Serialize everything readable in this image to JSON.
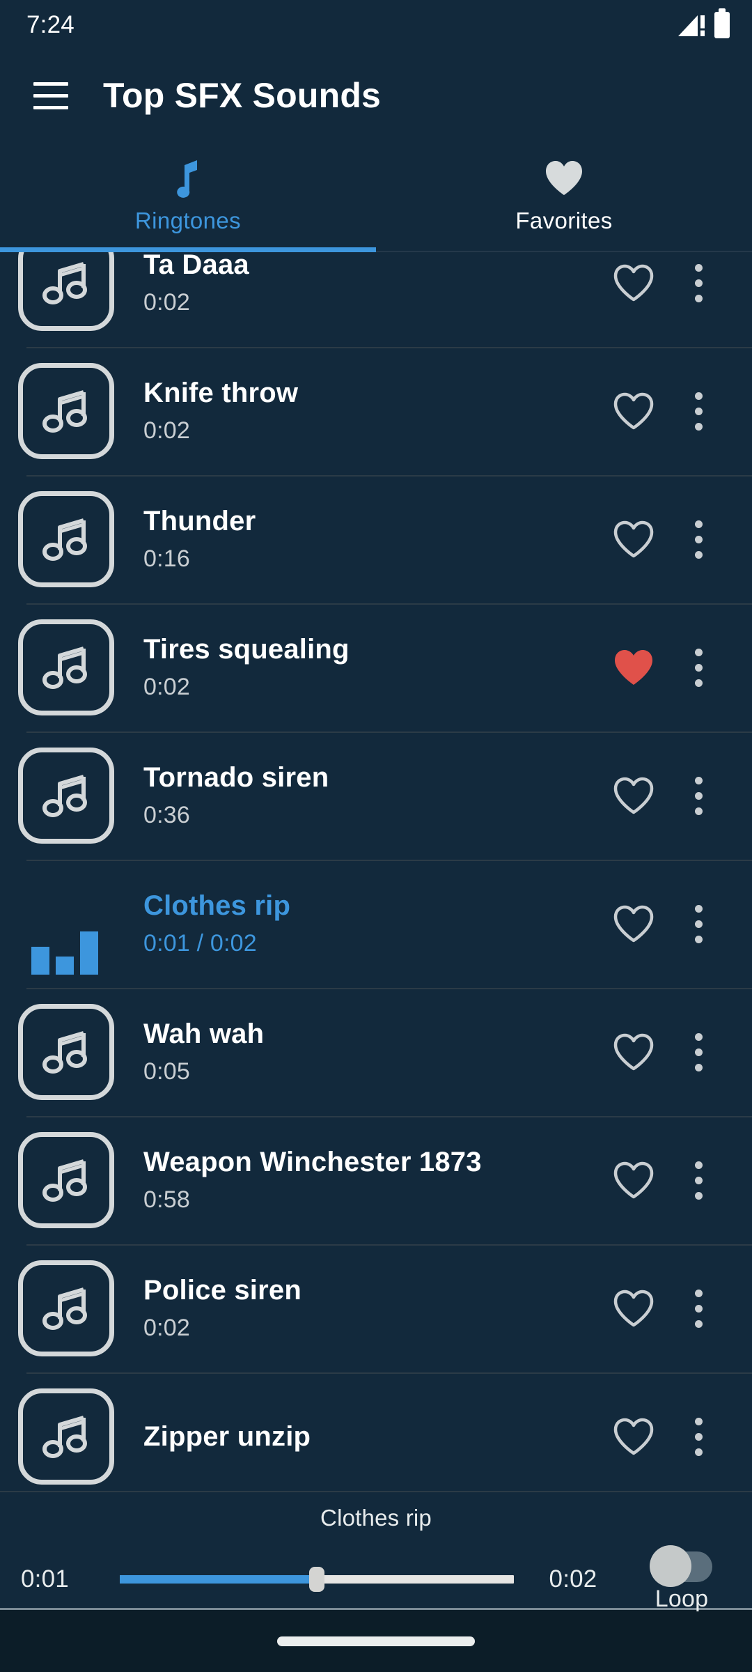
{
  "status_bar": {
    "time": "7:24",
    "signal_icon": "signal-warning-icon",
    "battery_icon": "battery-full-icon"
  },
  "app_bar": {
    "menu_icon": "hamburger-menu-icon",
    "title": "Top SFX Sounds"
  },
  "tabs": [
    {
      "label": "Ringtones",
      "icon": "music-note-icon",
      "active": true
    },
    {
      "label": "Favorites",
      "icon": "heart-filled-icon",
      "active": false
    }
  ],
  "list": {
    "clipped_top_item": true,
    "items": [
      {
        "title": "Ta Daaa",
        "duration": "0:02",
        "favorite": false,
        "playing": false,
        "icon": "music-note-icon"
      },
      {
        "title": "Knife throw",
        "duration": "0:02",
        "favorite": false,
        "playing": false,
        "icon": "music-note-icon"
      },
      {
        "title": "Thunder",
        "duration": "0:16",
        "favorite": false,
        "playing": false,
        "icon": "music-note-icon"
      },
      {
        "title": "Tires squealing",
        "duration": "0:02",
        "favorite": true,
        "playing": false,
        "icon": "music-note-icon"
      },
      {
        "title": "Tornado siren",
        "duration": "0:36",
        "favorite": false,
        "playing": false,
        "icon": "music-note-icon"
      },
      {
        "title": "Clothes rip",
        "duration": "0:01 / 0:02",
        "favorite": false,
        "playing": true,
        "icon": "equalizer-bars-icon"
      },
      {
        "title": "Wah wah",
        "duration": "0:05",
        "favorite": false,
        "playing": false,
        "icon": "music-note-icon"
      },
      {
        "title": "Weapon Winchester 1873",
        "duration": "0:58",
        "favorite": false,
        "playing": false,
        "icon": "music-note-icon"
      },
      {
        "title": "Police siren",
        "duration": "0:02",
        "favorite": false,
        "playing": false,
        "icon": "music-note-icon"
      },
      {
        "title": "Zipper unzip",
        "duration": "",
        "favorite": false,
        "playing": false,
        "icon": "music-note-icon"
      }
    ]
  },
  "player": {
    "title": "Clothes rip",
    "elapsed": "0:01",
    "total": "0:02",
    "progress_percent": 50,
    "loop_label": "Loop",
    "loop_enabled": false
  },
  "nav_bar": {
    "handle": "home-gesture-pill"
  },
  "colors": {
    "background": "#12293c",
    "accent": "#3d96dd",
    "favorite_red": "#e0514a",
    "text_primary": "#ffffff",
    "text_secondary": "#c9ced2",
    "divider": "#2b3b47",
    "nav_background": "#0c1d28"
  }
}
